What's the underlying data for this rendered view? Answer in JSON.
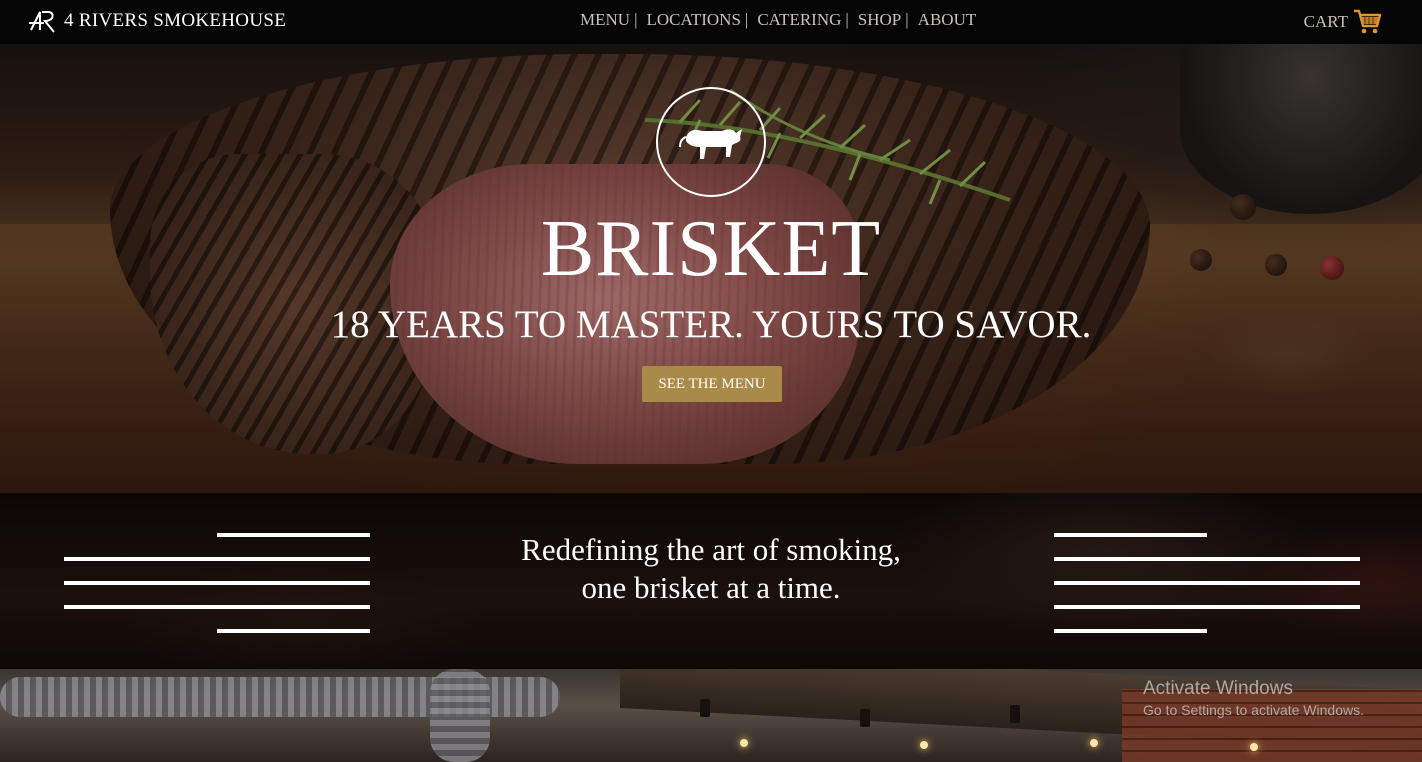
{
  "brand": {
    "name": "4 RIVERS SMOKEHOUSE",
    "logo_icon": "4r-logo-icon"
  },
  "nav": {
    "items": [
      {
        "label": "MENU",
        "sep": "|"
      },
      {
        "label": "LOCATIONS",
        "sep": "|"
      },
      {
        "label": "CATERING",
        "sep": "|"
      },
      {
        "label": "SHOP",
        "sep": "|"
      },
      {
        "label": "ABOUT",
        "sep": ""
      }
    ],
    "cart_label": "CART",
    "cart_icon": "shopping-cart-icon"
  },
  "hero": {
    "emblem_icon": "bull-icon",
    "title": "BRISKET",
    "subtitle": "18 YEARS TO MASTER. YOURS TO SAVOR.",
    "button_label": "SEE THE MENU"
  },
  "tagline": {
    "line1": "Redefining the art of smoking,",
    "line2": "one brisket at a time."
  },
  "watermark": {
    "title": "Activate Windows",
    "subtitle": "Go to Settings to activate Windows."
  },
  "colors": {
    "nav_bg": "#050505",
    "nav_text": "#c8c2b6",
    "button_gold": "#a98a48",
    "cart_orange": "#e0962e"
  }
}
